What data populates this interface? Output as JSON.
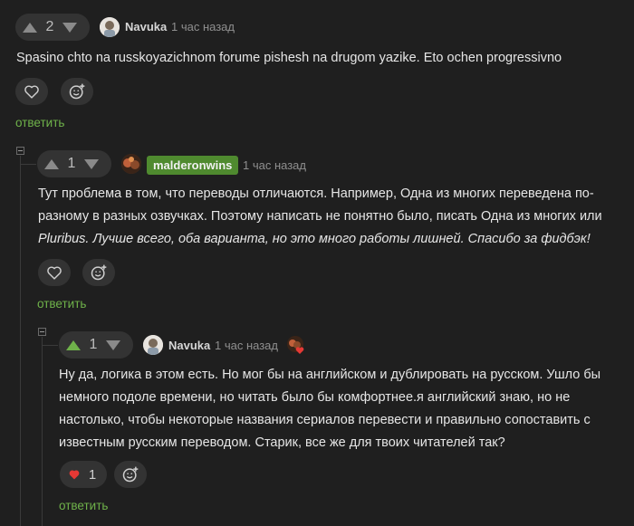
{
  "comments": [
    {
      "score": "2",
      "author": "Navuka",
      "time": "1 час назад",
      "text": "Spasino chto na russkoyazichnom forume pishesh na drugom yazike. Eto ochen progressivno",
      "reply_label": "ответить"
    },
    {
      "score": "1",
      "author": "malderonwins",
      "time": "1 час назад",
      "text_lines": [
        "Тут проблема в том, что переводы отличаются. Например, Одна из многих переведена по-",
        "разному в разных озвучках. Поэтому написать не понятно было, писать Одна из многих или"
      ],
      "text_italic": "Pluribus. Лучше всего, оба варианта, но это много работы лишней. Спасибо за фидбэк!",
      "reply_label": "ответить"
    },
    {
      "score": "1",
      "author": "Navuka",
      "time": "1 час назад",
      "text_lines": [
        "Ну да, логика в этом есть. Но мог бы на английском и дублировать на русском. Ушло бы",
        "немного подоле времени, но читать было бы комфортнее.я английский знаю, но не",
        "настолько, чтобы некоторые названия сериалов перевести и правильно сопоставить с",
        "известным русским переводом. Старик, все же для твоих читателей так?"
      ],
      "like_count": "1",
      "reply_label": "ответить"
    }
  ],
  "colors": {
    "accent": "#6fb24a",
    "badge": "#4f8a2f",
    "heart": "#e53935"
  }
}
